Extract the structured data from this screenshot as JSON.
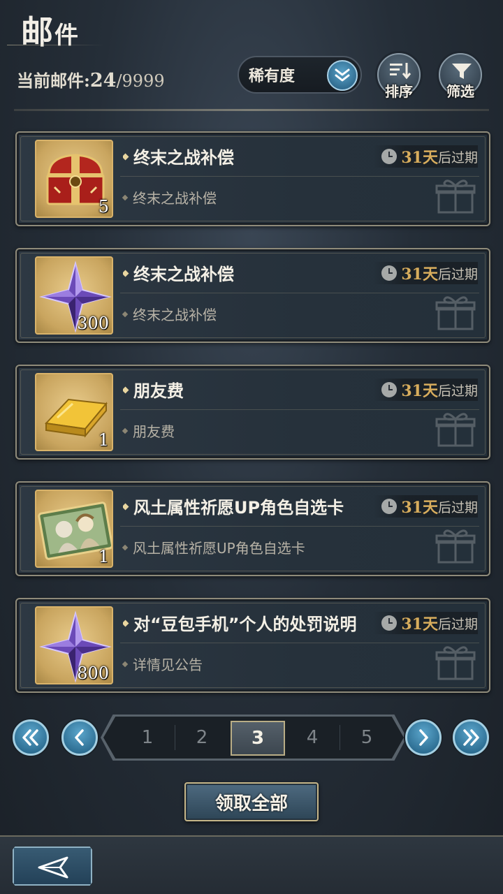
{
  "header": {
    "title_first": "邮",
    "title_rest": "件",
    "count_label": "当前邮件:",
    "count_current": "24",
    "count_max": "/9999"
  },
  "filters": {
    "rarity_label": "稀有度",
    "sort_label": "排序",
    "filter_label": "筛选"
  },
  "mails": [
    {
      "title": "终末之战补偿",
      "subtitle": "终末之战补偿",
      "item_icon": "treasure-chest-icon",
      "quantity": "5",
      "expiry_days": "31天",
      "expiry_suffix": "后过期"
    },
    {
      "title": "终末之战补偿",
      "subtitle": "终末之战补偿",
      "item_icon": "purple-star-crystal-icon",
      "quantity": "300",
      "expiry_days": "31天",
      "expiry_suffix": "后过期"
    },
    {
      "title": "朋友费",
      "subtitle": "朋友费",
      "item_icon": "gold-bar-icon",
      "quantity": "1",
      "expiry_days": "31天",
      "expiry_suffix": "后过期"
    },
    {
      "title": "风土属性祈愿UP角色自选卡",
      "subtitle": "风土属性祈愿UP角色自选卡",
      "item_icon": "character-card-icon",
      "quantity": "1",
      "expiry_days": "31天",
      "expiry_suffix": "后过期"
    },
    {
      "title": "对“豆包手机”个人的处罚说明",
      "subtitle": "详情见公告",
      "item_icon": "purple-star-crystal-icon",
      "quantity": "800",
      "expiry_days": "31天",
      "expiry_suffix": "后过期"
    }
  ],
  "pagination": {
    "pages": [
      "1",
      "2",
      "3",
      "4",
      "5"
    ],
    "current_page": "3"
  },
  "actions": {
    "claim_all_label": "领取全部"
  },
  "colors": {
    "expiry_gold": "#d8ad5d",
    "item_frame": "#d9b36a",
    "button_blue": "#1d5a7e"
  }
}
